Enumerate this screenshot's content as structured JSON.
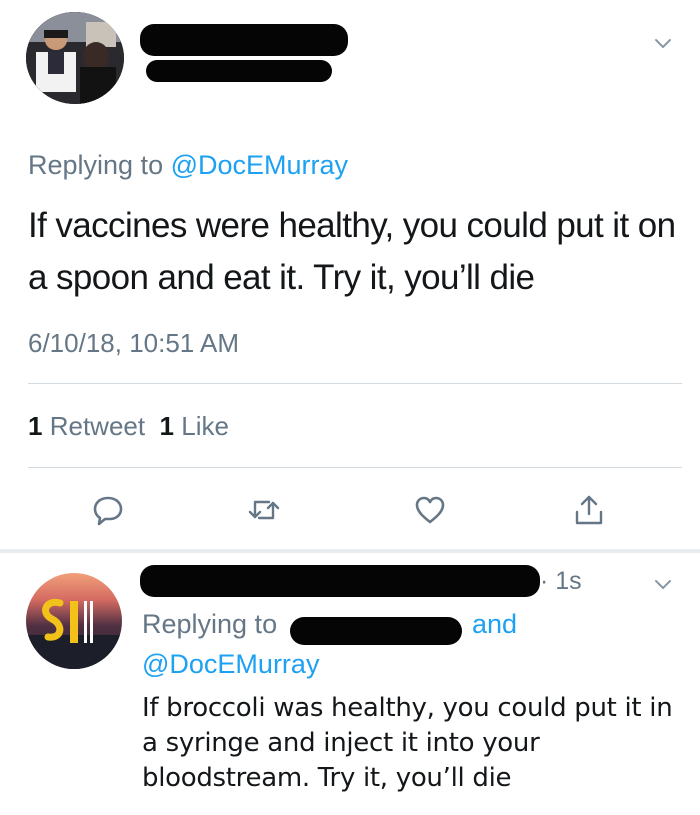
{
  "main_tweet": {
    "replying_prefix": "Replying to",
    "replying_handle": "@DocEMurray",
    "text": "If vaccines were healthy, you could put it on a spoon and eat it. Try it, you’ll die",
    "timestamp": "6/10/18, 10:51 AM",
    "retweet_count": "1",
    "retweet_label": "Retweet",
    "like_count": "1",
    "like_label": "Like",
    "actions": [
      "reply-icon",
      "retweet-icon",
      "like-icon",
      "share-icon"
    ]
  },
  "reply_tweet": {
    "time_ago": "· 1s",
    "replying_prefix": "Replying to",
    "and_label": "and",
    "replying_handle": "@DocEMurray",
    "text": "If broccoli was healthy, you could put it in a syringe and inject it into your bloodstream. Try it, you’ll die"
  },
  "colors": {
    "link": "#1da1f2",
    "muted": "#657786",
    "text": "#14171a",
    "divider": "#e6ecf0"
  }
}
